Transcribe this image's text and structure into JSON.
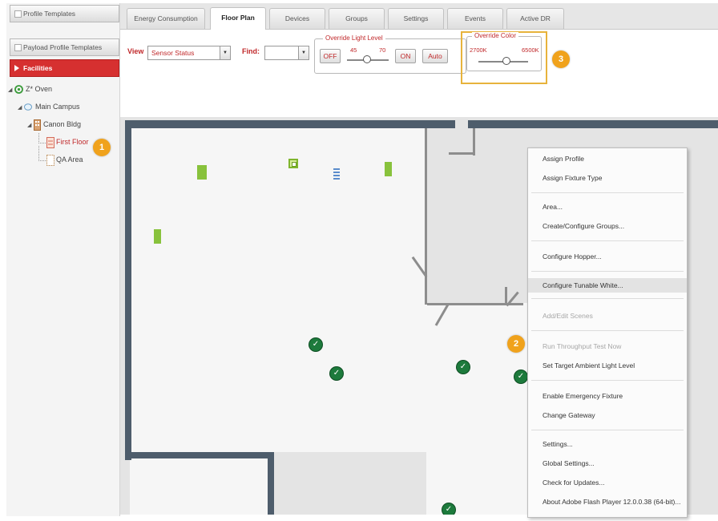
{
  "sidebar": {
    "buttons": [
      {
        "label": "Profile Templates"
      },
      {
        "label": "Payload Profile Templates"
      },
      {
        "label": "Facilities"
      }
    ],
    "tree": [
      {
        "label": "Z* Oven",
        "icon": "organization-icon"
      },
      {
        "label": "Main Campus",
        "icon": "campus-icon"
      },
      {
        "label": "Canon Bldg",
        "icon": "building-icon"
      },
      {
        "label": "First Floor",
        "icon": "floor-icon",
        "selected": true
      },
      {
        "label": "QA Area",
        "icon": "area-icon"
      }
    ]
  },
  "callouts": [
    "1",
    "2",
    "3"
  ],
  "tabs": [
    {
      "label": "Energy Consumption"
    },
    {
      "label": "Floor Plan",
      "active": true
    },
    {
      "label": "Devices"
    },
    {
      "label": "Groups"
    },
    {
      "label": "Settings"
    },
    {
      "label": "Events"
    },
    {
      "label": "Active DR"
    }
  ],
  "toolbar": {
    "view_label": "View",
    "view_value": "Sensor Status",
    "find_label": "Find:",
    "find_value": "",
    "light_level": {
      "legend": "Override Light Level",
      "off_label": "OFF",
      "min": "45",
      "max": "70",
      "on_label": "ON",
      "auto_label": "Auto"
    },
    "color": {
      "legend": "Override Color",
      "min": "2700K",
      "max": "6500K"
    }
  },
  "context_menu": {
    "items": [
      {
        "label": "Assign Profile",
        "enabled": true
      },
      {
        "label": "Assign Fixture Type",
        "enabled": true
      },
      {
        "label": "Area...",
        "enabled": true
      },
      {
        "label": "Create/Configure Groups...",
        "enabled": true
      },
      {
        "label": "Configure Hopper...",
        "enabled": true
      },
      {
        "label": "Configure Tunable White...",
        "enabled": true,
        "hovered": true
      },
      {
        "label": "Add/Edit Scenes",
        "enabled": false
      },
      {
        "label": "Run Throughput Test Now",
        "enabled": false
      },
      {
        "label": "Set Target Ambient Light Level",
        "enabled": true
      },
      {
        "label": "Enable Emergency Fixture",
        "enabled": true
      },
      {
        "label": "Change Gateway",
        "enabled": true
      },
      {
        "label": "Settings...",
        "enabled": true
      },
      {
        "label": "Global Settings...",
        "enabled": true
      },
      {
        "label": "Check for Updates...",
        "enabled": true
      },
      {
        "label": "About Adobe Flash Player 12.0.0.38 (64-bit)...",
        "enabled": true
      }
    ]
  },
  "colors": {
    "accent_red": "#d63030",
    "callout_orange": "#f0a21c",
    "fixture_green": "#88c23c",
    "status_ok_green": "#1d7a3c",
    "wall_slate": "#4e5d6c"
  }
}
